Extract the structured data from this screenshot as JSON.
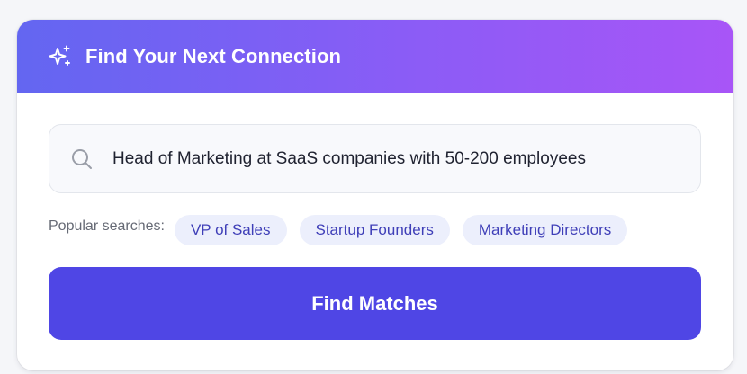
{
  "header": {
    "title": "Find Your Next Connection",
    "icon": "sparkle-icon"
  },
  "search": {
    "icon": "search-icon",
    "value": "Head of Marketing at SaaS companies with 50-200 employees"
  },
  "popular": {
    "label": "Popular searches:",
    "chips": [
      {
        "label": "VP of Sales"
      },
      {
        "label": "Startup Founders"
      },
      {
        "label": "Marketing Directors"
      }
    ]
  },
  "action": {
    "label": "Find Matches"
  },
  "colors": {
    "header_gradient_start": "#6366f1",
    "header_gradient_end": "#a855f7",
    "primary": "#4f46e5",
    "chip_bg": "#eceffc",
    "chip_text": "#3f3fb8"
  }
}
